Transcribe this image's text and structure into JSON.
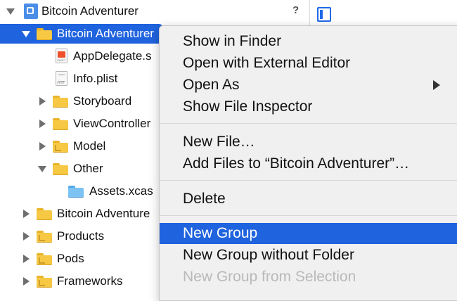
{
  "navigator": {
    "project_name": "Bitcoin Adventurer",
    "help_glyph": "?",
    "items": [
      {
        "label": "Bitcoin Adventurer",
        "kind": "folder",
        "expanded": true,
        "selected": true
      },
      {
        "label": "AppDelegate.s",
        "kind": "swift-file"
      },
      {
        "label": "Info.plist",
        "kind": "plist-file"
      },
      {
        "label": "Storyboard",
        "kind": "folder"
      },
      {
        "label": "ViewController",
        "kind": "folder"
      },
      {
        "label": "Model",
        "kind": "folder"
      },
      {
        "label": "Other",
        "kind": "folder",
        "expanded": true
      },
      {
        "label": "Assets.xcas",
        "kind": "asset-catalog"
      },
      {
        "label": "Bitcoin Adventure",
        "kind": "folder"
      },
      {
        "label": "Products",
        "kind": "folder"
      },
      {
        "label": "Pods",
        "kind": "folder"
      },
      {
        "label": "Frameworks",
        "kind": "folder"
      }
    ]
  },
  "context_menu": {
    "items": [
      {
        "label": "Show in Finder"
      },
      {
        "label": "Open with External Editor"
      },
      {
        "label": "Open As",
        "has_submenu": true
      },
      {
        "label": "Show File Inspector"
      },
      {
        "label": "New File…"
      },
      {
        "label": "Add Files to “Bitcoin Adventurer”…"
      },
      {
        "label": "Delete"
      },
      {
        "label": "New Group",
        "highlighted": true
      },
      {
        "label": "New Group without Folder"
      },
      {
        "label": "New Group from Selection",
        "disabled": true
      }
    ]
  },
  "colors": {
    "selection": "#1f63de",
    "folder": "#f6c843",
    "menu_background": "#f0f0f0",
    "disabled_text": "#b9b9b9"
  }
}
